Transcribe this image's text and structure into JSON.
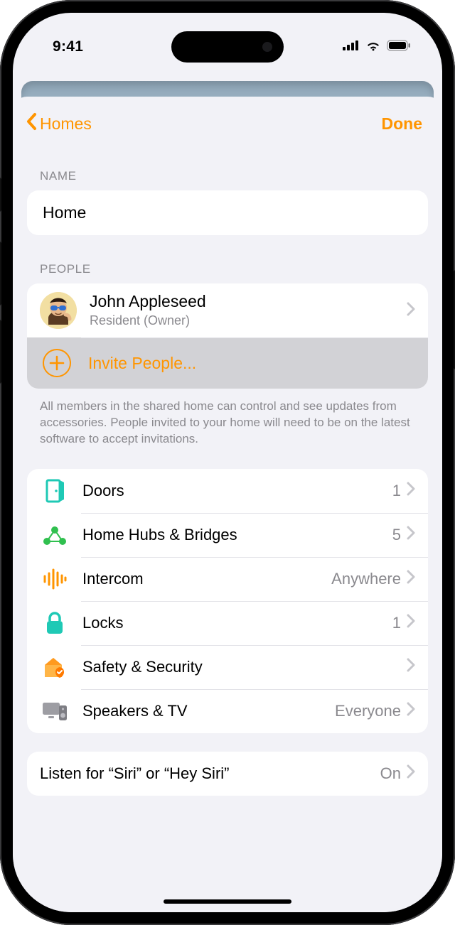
{
  "status": {
    "time": "9:41"
  },
  "nav": {
    "back_label": "Homes",
    "done_label": "Done"
  },
  "sections": {
    "name": {
      "header": "NAME",
      "value": "Home"
    },
    "people": {
      "header": "PEOPLE",
      "members": [
        {
          "name": "John Appleseed",
          "role": "Resident (Owner)"
        }
      ],
      "invite_label": "Invite People...",
      "footer": "All members in the shared home can control and see updates from accessories. People invited to your home will need to be on the latest software to accept invitations."
    }
  },
  "categories": [
    {
      "icon": "door",
      "label": "Doors",
      "value": "1"
    },
    {
      "icon": "hubs",
      "label": "Home Hubs & Bridges",
      "value": "5"
    },
    {
      "icon": "intercom",
      "label": "Intercom",
      "value": "Anywhere"
    },
    {
      "icon": "lock",
      "label": "Locks",
      "value": "1"
    },
    {
      "icon": "safety",
      "label": "Safety & Security",
      "value": ""
    },
    {
      "icon": "speakers",
      "label": "Speakers & TV",
      "value": "Everyone"
    }
  ],
  "siri": {
    "label": "Listen for “Siri” or “Hey Siri”",
    "value": "On"
  }
}
